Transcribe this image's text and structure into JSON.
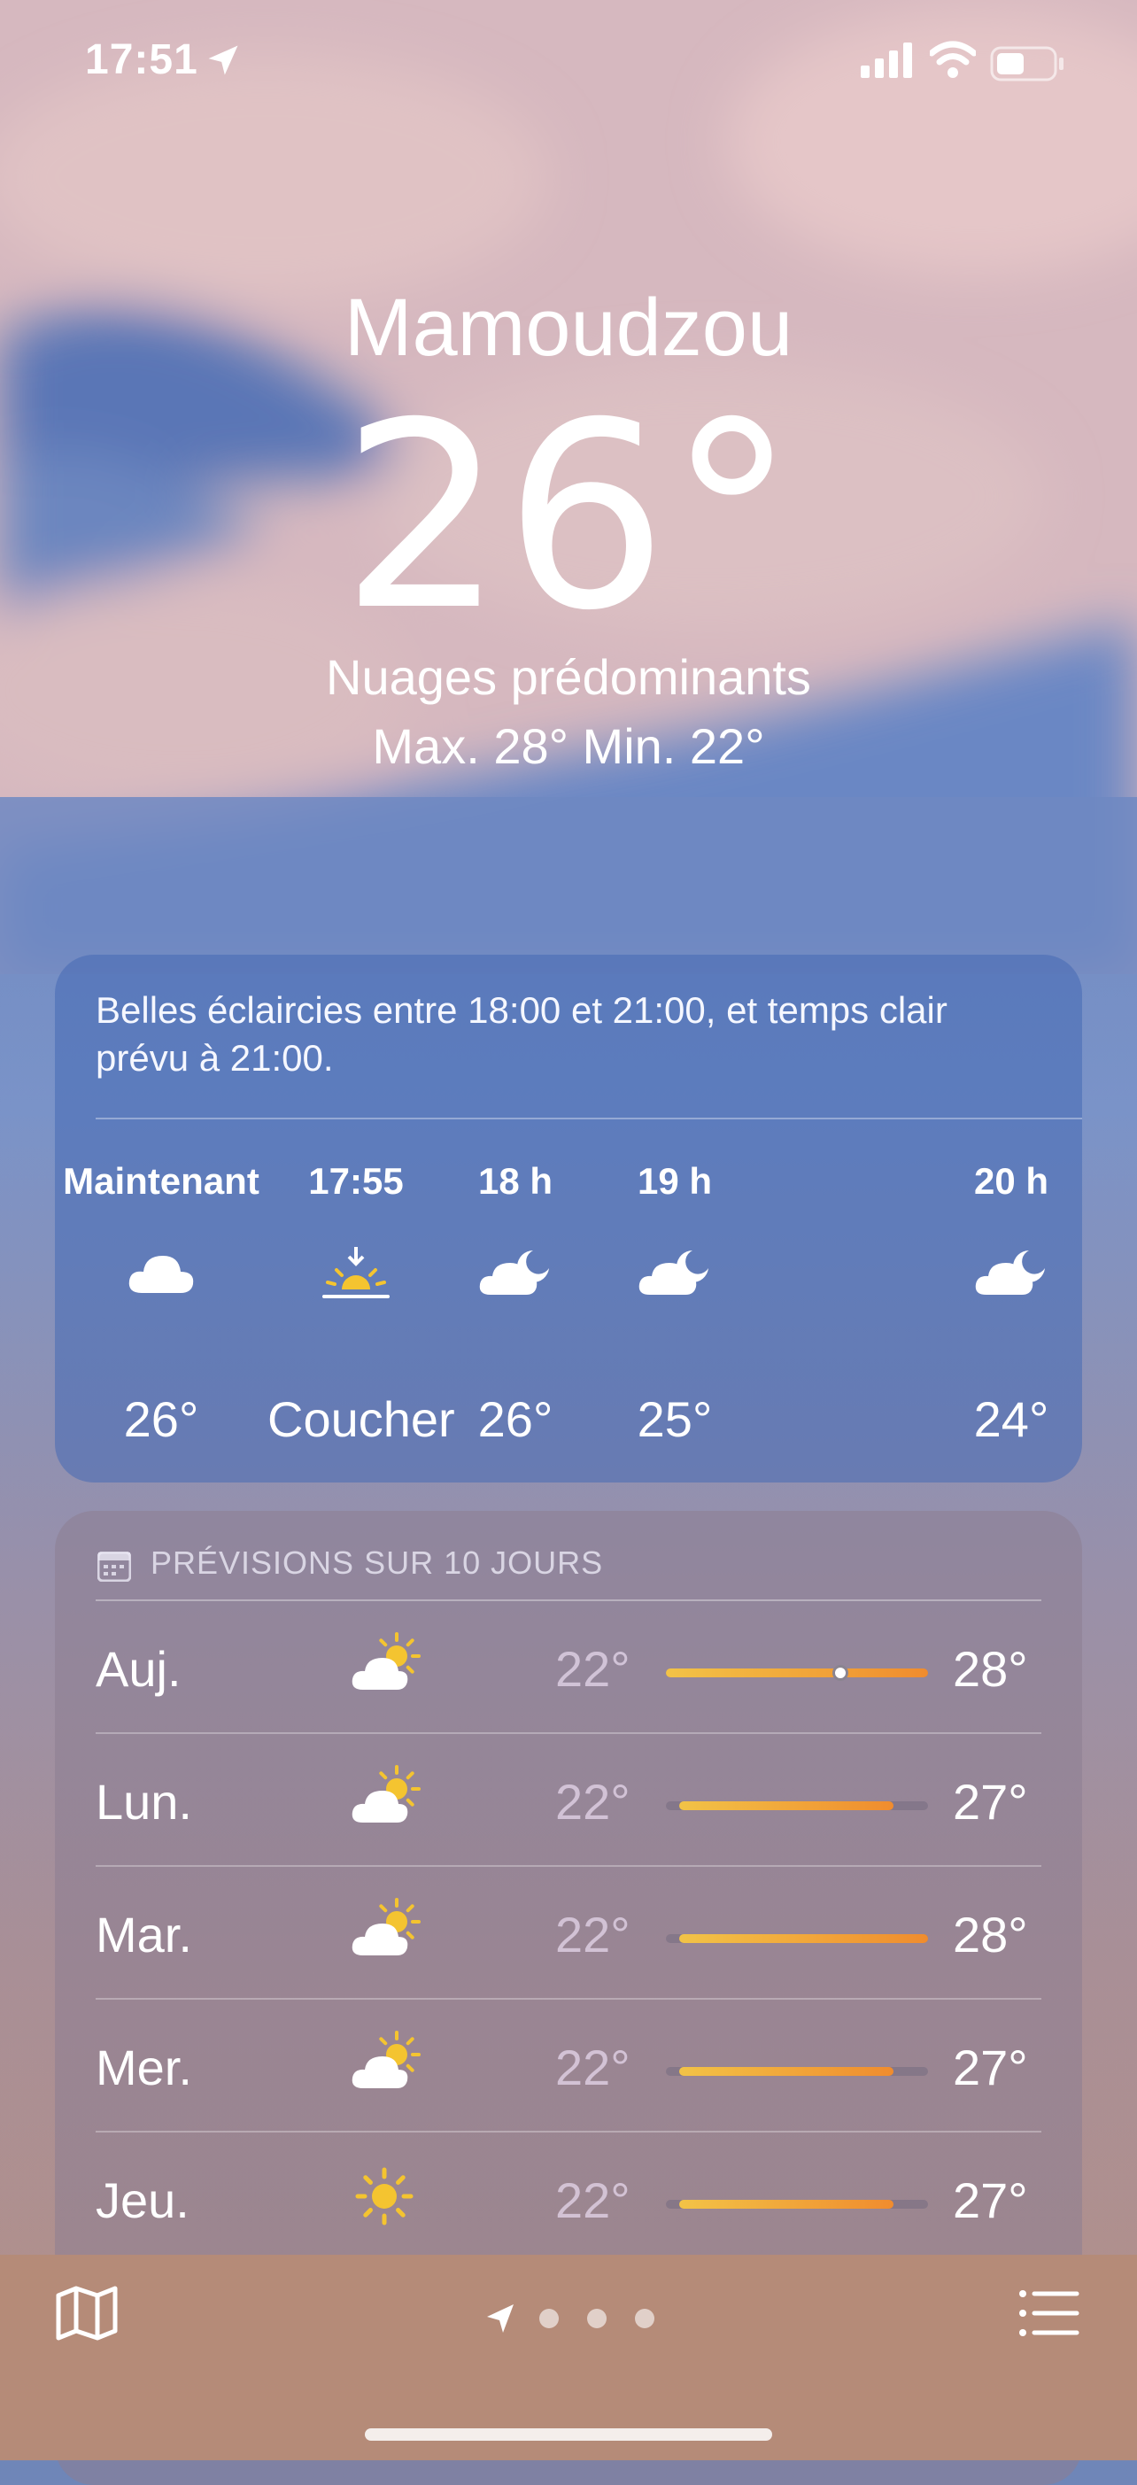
{
  "status": {
    "time": "17:51"
  },
  "hero": {
    "city": "Mamoudzou",
    "temperature": "26°",
    "condition": "Nuages prédominants",
    "hi_lo": "Max. 28°  Min. 22°"
  },
  "hourly": {
    "summary": "Belles éclaircies entre 18:00 et 21:00, et temps clair prévu à 21:00.",
    "items": [
      {
        "label": "Maintenant",
        "icon": "cloud-icon",
        "value": "26°"
      },
      {
        "label": "17:55",
        "icon": "sunset-icon",
        "value": "Coucher"
      },
      {
        "label": "18 h",
        "icon": "cloud-moon-icon",
        "value": "26°"
      },
      {
        "label": "19 h",
        "icon": "cloud-moon-icon",
        "value": "25°"
      },
      {
        "label": "20 h",
        "icon": "cloud-moon-icon",
        "value": "24°"
      }
    ]
  },
  "forecast": {
    "header": "PRÉVISIONS SUR 10 JOURS",
    "range_min": 22,
    "range_max": 28,
    "days": [
      {
        "day": "Auj.",
        "icon": "partly-cloudy-sun-icon",
        "min": "22°",
        "max": "28°",
        "low": 22,
        "high": 28,
        "current": 26
      },
      {
        "day": "Lun.",
        "icon": "partly-cloudy-sun-icon",
        "min": "22°",
        "max": "27°",
        "low": 22.3,
        "high": 27.2
      },
      {
        "day": "Mar.",
        "icon": "partly-cloudy-sun-icon",
        "min": "22°",
        "max": "28°",
        "low": 22.3,
        "high": 28
      },
      {
        "day": "Mer.",
        "icon": "partly-cloudy-sun-icon",
        "min": "22°",
        "max": "27°",
        "low": 22.3,
        "high": 27.2
      },
      {
        "day": "Jeu.",
        "icon": "sun-icon",
        "min": "22°",
        "max": "27°",
        "low": 22.3,
        "high": 27.2
      }
    ]
  },
  "colors": {
    "sun": "#f4c430",
    "bar_start": "#f2c347",
    "bar_end": "#f08c2e"
  }
}
